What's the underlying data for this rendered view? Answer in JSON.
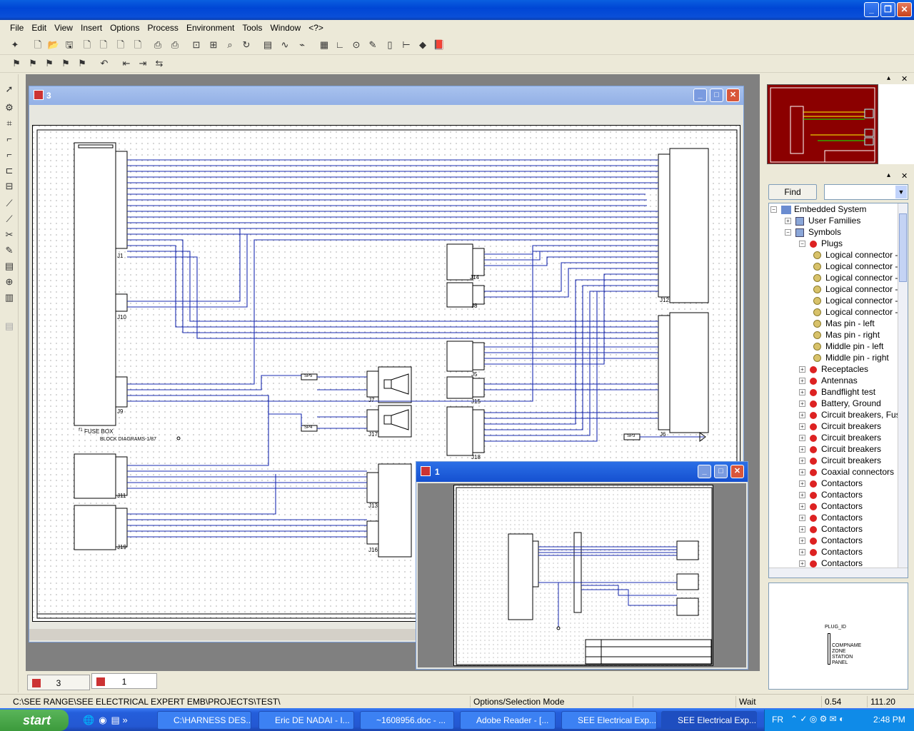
{
  "menu": [
    "File",
    "Edit",
    "View",
    "Insert",
    "Options",
    "Process",
    "Environment",
    "Tools",
    "Window",
    "<?>"
  ],
  "window_child1_title": "3",
  "window_child2_title": "1",
  "find": {
    "button": "Find",
    "value": ""
  },
  "tree": {
    "root": "Embedded System",
    "items": [
      {
        "label": "User Families",
        "indent": 1,
        "icon": "family"
      },
      {
        "label": "Symbols",
        "indent": 1,
        "icon": "family"
      },
      {
        "label": "Plugs",
        "indent": 2,
        "icon": "red-pin"
      },
      {
        "label": "Logical connector -",
        "indent": 3,
        "icon": "symbol"
      },
      {
        "label": "Logical connector -",
        "indent": 3,
        "icon": "symbol"
      },
      {
        "label": "Logical connector -",
        "indent": 3,
        "icon": "symbol"
      },
      {
        "label": "Logical connector -",
        "indent": 3,
        "icon": "symbol"
      },
      {
        "label": "Logical connector -",
        "indent": 3,
        "icon": "symbol"
      },
      {
        "label": "Logical connector -",
        "indent": 3,
        "icon": "symbol"
      },
      {
        "label": "Mas pin - left",
        "indent": 3,
        "icon": "symbol"
      },
      {
        "label": "Mas pin - right",
        "indent": 3,
        "icon": "symbol"
      },
      {
        "label": "Middle pin - left",
        "indent": 3,
        "icon": "symbol"
      },
      {
        "label": "Middle pin - right",
        "indent": 3,
        "icon": "symbol"
      },
      {
        "label": "Receptacles",
        "indent": 2,
        "icon": "red-pin"
      },
      {
        "label": "Antennas",
        "indent": 2,
        "icon": "red-pin"
      },
      {
        "label": "Bandflight test",
        "indent": 2,
        "icon": "red-pin"
      },
      {
        "label": "Battery, Ground",
        "indent": 2,
        "icon": "red-pin"
      },
      {
        "label": "Circuit breakers, Fuses",
        "indent": 2,
        "icon": "red-pin"
      },
      {
        "label": "Circuit breakers",
        "indent": 2,
        "icon": "red-pin"
      },
      {
        "label": "Circuit breakers",
        "indent": 2,
        "icon": "red-pin"
      },
      {
        "label": "Circuit breakers",
        "indent": 2,
        "icon": "red-pin"
      },
      {
        "label": "Circuit breakers",
        "indent": 2,
        "icon": "red-pin"
      },
      {
        "label": "Coaxial connectors",
        "indent": 2,
        "icon": "red-pin"
      },
      {
        "label": "Contactors",
        "indent": 2,
        "icon": "red-pin"
      },
      {
        "label": "Contactors",
        "indent": 2,
        "icon": "red-pin"
      },
      {
        "label": "Contactors",
        "indent": 2,
        "icon": "red-pin"
      },
      {
        "label": "Contactors",
        "indent": 2,
        "icon": "red-pin"
      },
      {
        "label": "Contactors",
        "indent": 2,
        "icon": "red-pin"
      },
      {
        "label": "Contactors",
        "indent": 2,
        "icon": "red-pin"
      },
      {
        "label": "Contactors",
        "indent": 2,
        "icon": "red-pin"
      },
      {
        "label": "Contactors",
        "indent": 2,
        "icon": "red-pin"
      }
    ]
  },
  "preview": {
    "plug_id": "PLUG_ID",
    "attrs": [
      "COMPNAME",
      "ZONE",
      "STATION",
      "PANEL"
    ]
  },
  "schematic": {
    "fuse_box": "FUSE BOX",
    "f1": "f1",
    "block_diag": "BLOCK DIAGRAMS-1/87",
    "connectors": [
      "J1",
      "J10",
      "J9",
      "J11",
      "J19",
      "J14",
      "J8",
      "J5",
      "J15",
      "J18",
      "J7",
      "J17",
      "J13",
      "J16",
      "J12",
      "J6"
    ],
    "splices": [
      "SP5",
      "SP4",
      "SP3"
    ]
  },
  "bottom_tabs": [
    "3",
    "1"
  ],
  "status": {
    "path": "C:\\SEE RANGE\\SEE ELECTRICAL EXPERT EMB\\PROJECTS\\TEST\\",
    "mode": "Options/Selection Mode",
    "state": "Wait",
    "x": "0.54",
    "y": "111.20"
  },
  "taskbar": {
    "start": "start",
    "tasks": [
      "C:\\HARNESS DES...",
      "Eric DE NADAI - I...",
      "~1608956.doc - ...",
      "Adobe Reader - [...",
      "SEE Electrical Exp...",
      "SEE Electrical Exp..."
    ],
    "lang": "FR",
    "clock": "2:48 PM"
  }
}
